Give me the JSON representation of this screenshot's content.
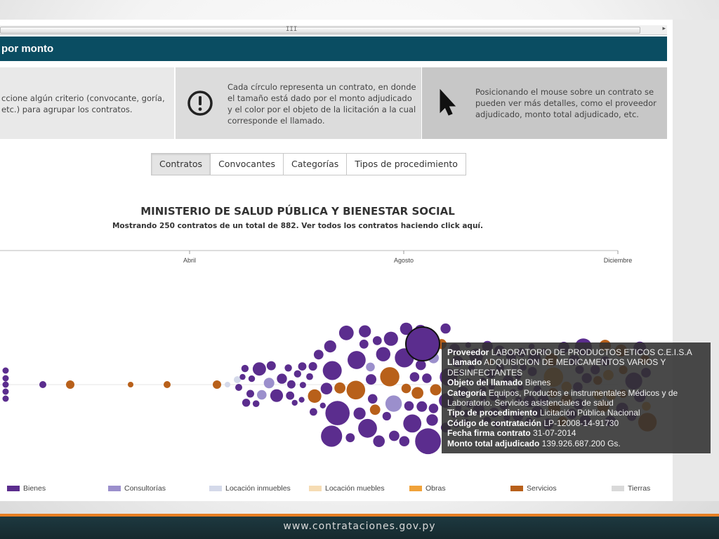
{
  "scrollbar": {
    "grip": "III",
    "arrow": "▸"
  },
  "header": {
    "title": "por monto"
  },
  "info": {
    "panel1": "ccione algún criterio (convocante, goría, etc.) para agrupar los contratos.",
    "panel2": "Cada círculo representa un contrato, en donde el tamaño está dado por el monto adjudicado y el color por el objeto de la licitación a la cual corresponde el llamado.",
    "panel3": "Posicionando el mouse sobre un contrato se pueden ver más detalles, como el proveedor adjudicado, monto total adjudicado, etc.",
    "alert_icon": "exclamation-circle-icon",
    "cursor_icon": "mouse-pointer-icon"
  },
  "tabs": [
    {
      "label": "Contratos",
      "active": true
    },
    {
      "label": "Convocantes",
      "active": false
    },
    {
      "label": "Categorías",
      "active": false
    },
    {
      "label": "Tipos de procedimiento",
      "active": false
    }
  ],
  "chart": {
    "title": "MINISTERIO DE SALUD PÚBLICA Y BIENESTAR SOCIAL",
    "subtitle_prefix": "Mostrando 250 contratos de un total de 882. Ver todos los contratos haciendo click ",
    "subtitle_link": "aquí",
    "subtitle_suffix": "."
  },
  "chart_data": {
    "type": "scatter",
    "title": "MINISTERIO DE SALUD PÚBLICA Y BIENESTAR SOCIAL",
    "x_axis_ticks": [
      "Abril",
      "Agosto",
      "Diciembre"
    ],
    "x_scale": "time (months)",
    "size_encodes": "monto adjudicado",
    "color_encodes": "objeto de la licitación",
    "series": [
      {
        "name": "Bienes",
        "color": "#5b2d8e"
      },
      {
        "name": "Consultorías",
        "color": "#9b8fcc"
      },
      {
        "name": "Locación inmuebles",
        "color": "#d4d9ea"
      },
      {
        "name": "Locación muebles",
        "color": "#f6dcb4"
      },
      {
        "name": "Obras",
        "color": "#f0a23a"
      },
      {
        "name": "Servicios",
        "color": "#b8601a"
      },
      {
        "name": "Tierras",
        "color": "#d9d9d9"
      }
    ]
  },
  "tooltip": {
    "proveedor_label": "Proveedor",
    "proveedor_value": "LABORATORIO DE PRODUCTOS ETICOS C.E.I.S.A",
    "llamado_label": "Llamado",
    "llamado_value": "ADQUISICION DE MEDICAMENTOS VARIOS Y DESINFECTANTES",
    "objeto_label": "Objeto del llamado",
    "objeto_value": "Bienes",
    "categoria_label": "Categoría",
    "categoria_value": "Equipos, Productos e instrumentales Médicos y de Laboratorio. Servicios asistenciales de salud",
    "tipo_label": "Tipo de procedimiento",
    "tipo_value": "Licitación Pública Nacional",
    "codigo_label": "Código de contratación",
    "codigo_value": "LP-12008-14-91730",
    "fecha_label": "Fecha firma contrato",
    "fecha_value": "31-07-2014",
    "monto_label": "Monto total adjudicado",
    "monto_value": "139.926.687.200 Gs."
  },
  "footer": {
    "url": "www.contrataciones.gov.py"
  },
  "colors": {
    "header_bg": "#0a4d62",
    "bienes": "#5b2d8e",
    "servicios": "#b8601a",
    "obras": "#f0a23a",
    "footer_accent": "#e67e22"
  }
}
